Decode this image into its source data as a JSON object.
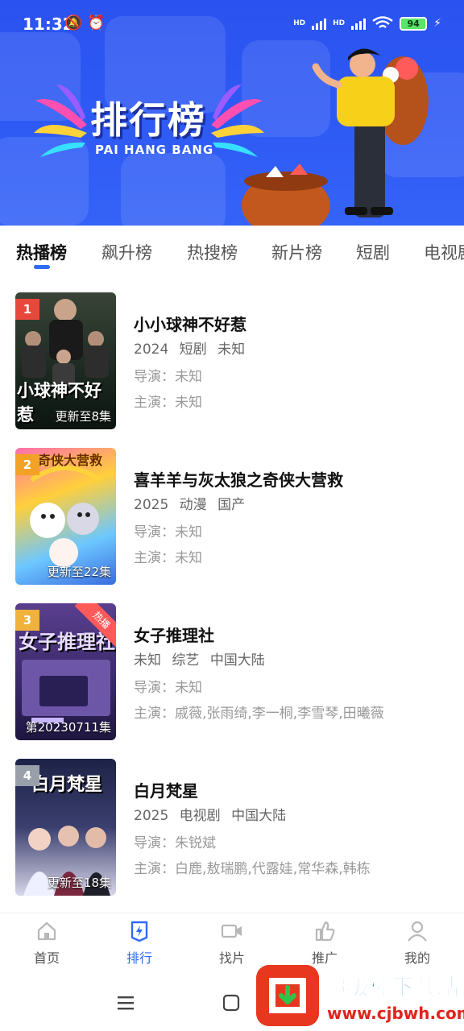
{
  "status_bar": {
    "time": "11:32",
    "network_1": "HD",
    "network_2": "HD",
    "wifi_label": "6",
    "battery": "94"
  },
  "banner": {
    "title": "排行榜",
    "subtitle": "PAI HANG BANG"
  },
  "tabs": [
    {
      "label": "热播榜",
      "active": true
    },
    {
      "label": "飙升榜",
      "active": false
    },
    {
      "label": "热搜榜",
      "active": false
    },
    {
      "label": "新片榜",
      "active": false
    },
    {
      "label": "短剧",
      "active": false
    },
    {
      "label": "电视剧",
      "active": false
    }
  ],
  "list": [
    {
      "rank": "1",
      "rank_color": "#e8483b",
      "poster_text": "小球神不好惹",
      "episodes": "更新至8集",
      "title": "小小球神不好惹",
      "meta": [
        "2024",
        "短剧",
        "未知"
      ],
      "director": "导演：未知",
      "cast": "主演：未知",
      "hot_badge": ""
    },
    {
      "rank": "2",
      "rank_color": "#f3a226",
      "poster_text": "奇侠大营救",
      "episodes": "更新至22集",
      "title": "喜羊羊与灰太狼之奇侠大营救",
      "meta": [
        "2025",
        "动漫",
        "国产"
      ],
      "director": "导演：未知",
      "cast": "主演：未知",
      "hot_badge": ""
    },
    {
      "rank": "3",
      "rank_color": "#f0b23a",
      "poster_text": "女子推理社",
      "episodes": "第20230711集",
      "title": "女子推理社",
      "meta": [
        "未知",
        "综艺",
        "中国大陆"
      ],
      "director": "导演：未知",
      "cast": "主演：戚薇,张雨绮,李一桐,李雪琴,田曦薇",
      "hot_badge": "热播"
    },
    {
      "rank": "4",
      "rank_color": "#9aa0aa",
      "poster_text": "白月梵星",
      "episodes": "更新至18集",
      "title": "白月梵星",
      "meta": [
        "2025",
        "电视剧",
        "中国大陆"
      ],
      "director": "导演：朱锐斌",
      "cast": "主演：白鹿,敖瑞鹏,代露娃,常华森,韩栋",
      "hot_badge": ""
    }
  ],
  "bottom_nav": [
    {
      "label": "首页",
      "icon": "home-icon",
      "active": false
    },
    {
      "label": "排行",
      "icon": "ranking-icon",
      "active": true
    },
    {
      "label": "找片",
      "icon": "video-camera-icon",
      "active": false
    },
    {
      "label": "推广",
      "icon": "thumbs-up-icon",
      "active": false
    },
    {
      "label": "我的",
      "icon": "user-icon",
      "active": false
    }
  ],
  "watermark": {
    "title": "超级棒下载站",
    "url": "www.cjbwh.com"
  },
  "colors": {
    "accent": "#2f6bf2",
    "banner_blue": "#2f5bf5"
  }
}
